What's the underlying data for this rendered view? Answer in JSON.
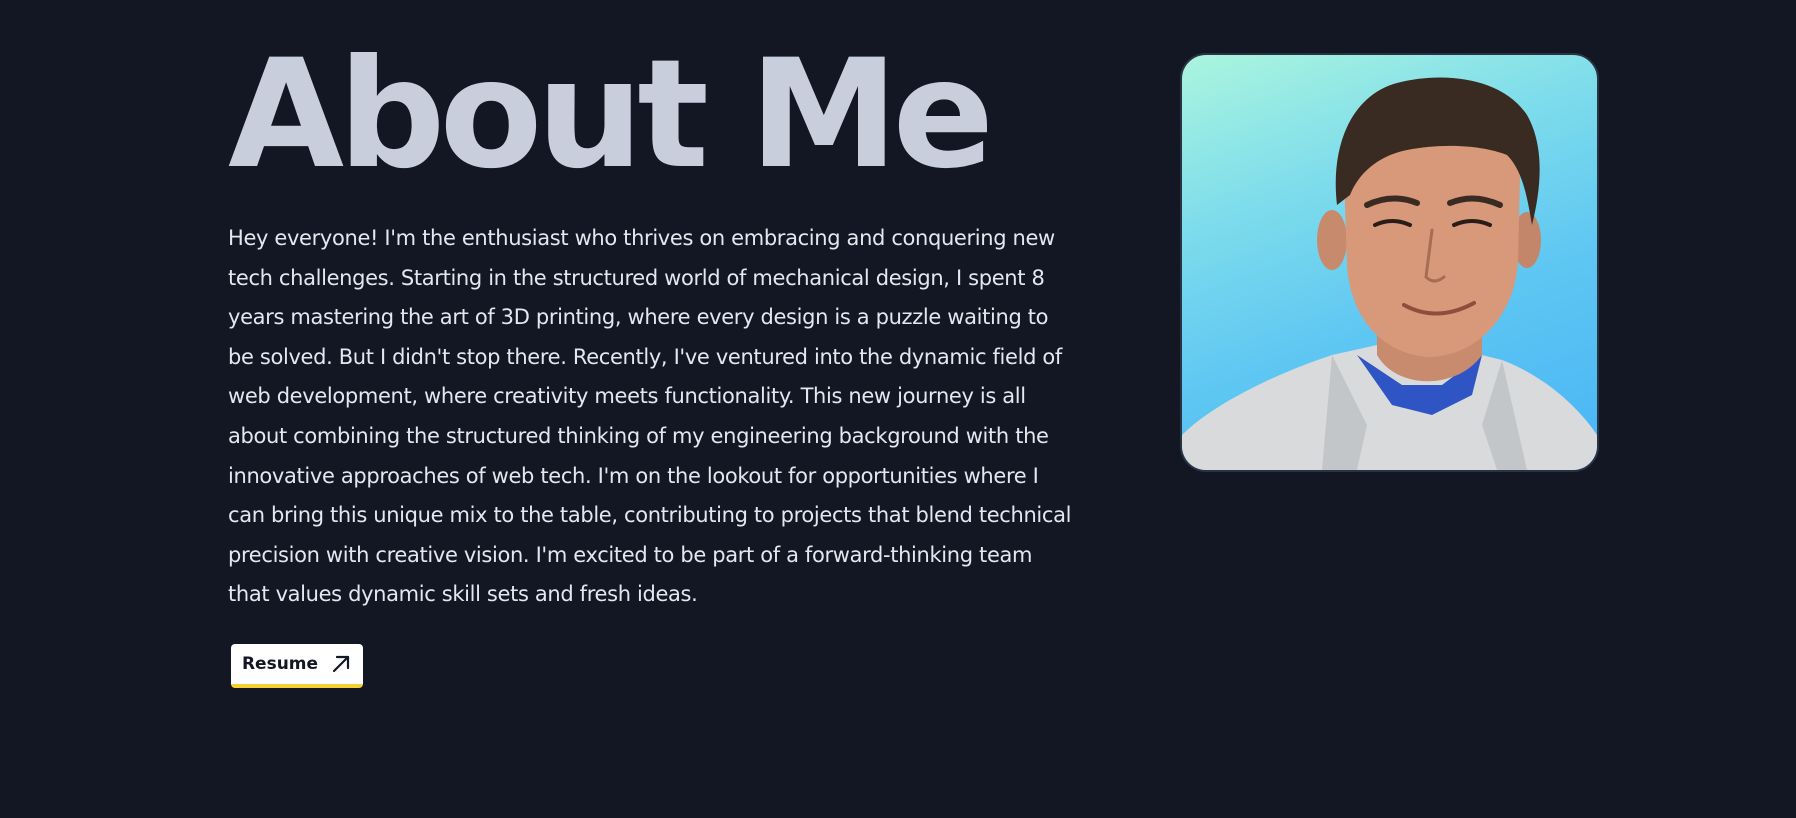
{
  "about": {
    "heading": "About Me",
    "bio": "Hey everyone! I'm the enthusiast who thrives on embracing and conquering new tech challenges. Starting in the structured world of mechanical design, I spent 8 years mastering the art of 3D printing, where every design is a puzzle waiting to be solved. But I didn't stop there. Recently, I've ventured into the dynamic field of web development, where creativity meets functionality. This new journey is all about combining the structured thinking of my engineering background with the innovative approaches of web tech. I'm on the lookout for opportunities where I can bring this unique mix to the table, contributing to projects that blend technical precision with creative vision. I'm excited to be part of a forward-thinking team that values dynamic skill sets and fresh ideas.",
    "resume_label": "Resume",
    "resume_icon": "arrow-up-right-icon",
    "photo": "profile-photo"
  },
  "colors": {
    "background": "#131723",
    "heading": "#c9cedd",
    "body_text": "#e4e7ef",
    "button_bg": "#ffffff",
    "button_accent": "#f5d033",
    "photo_gradient_start": "#abf5de",
    "photo_gradient_end": "#48b4f6"
  }
}
